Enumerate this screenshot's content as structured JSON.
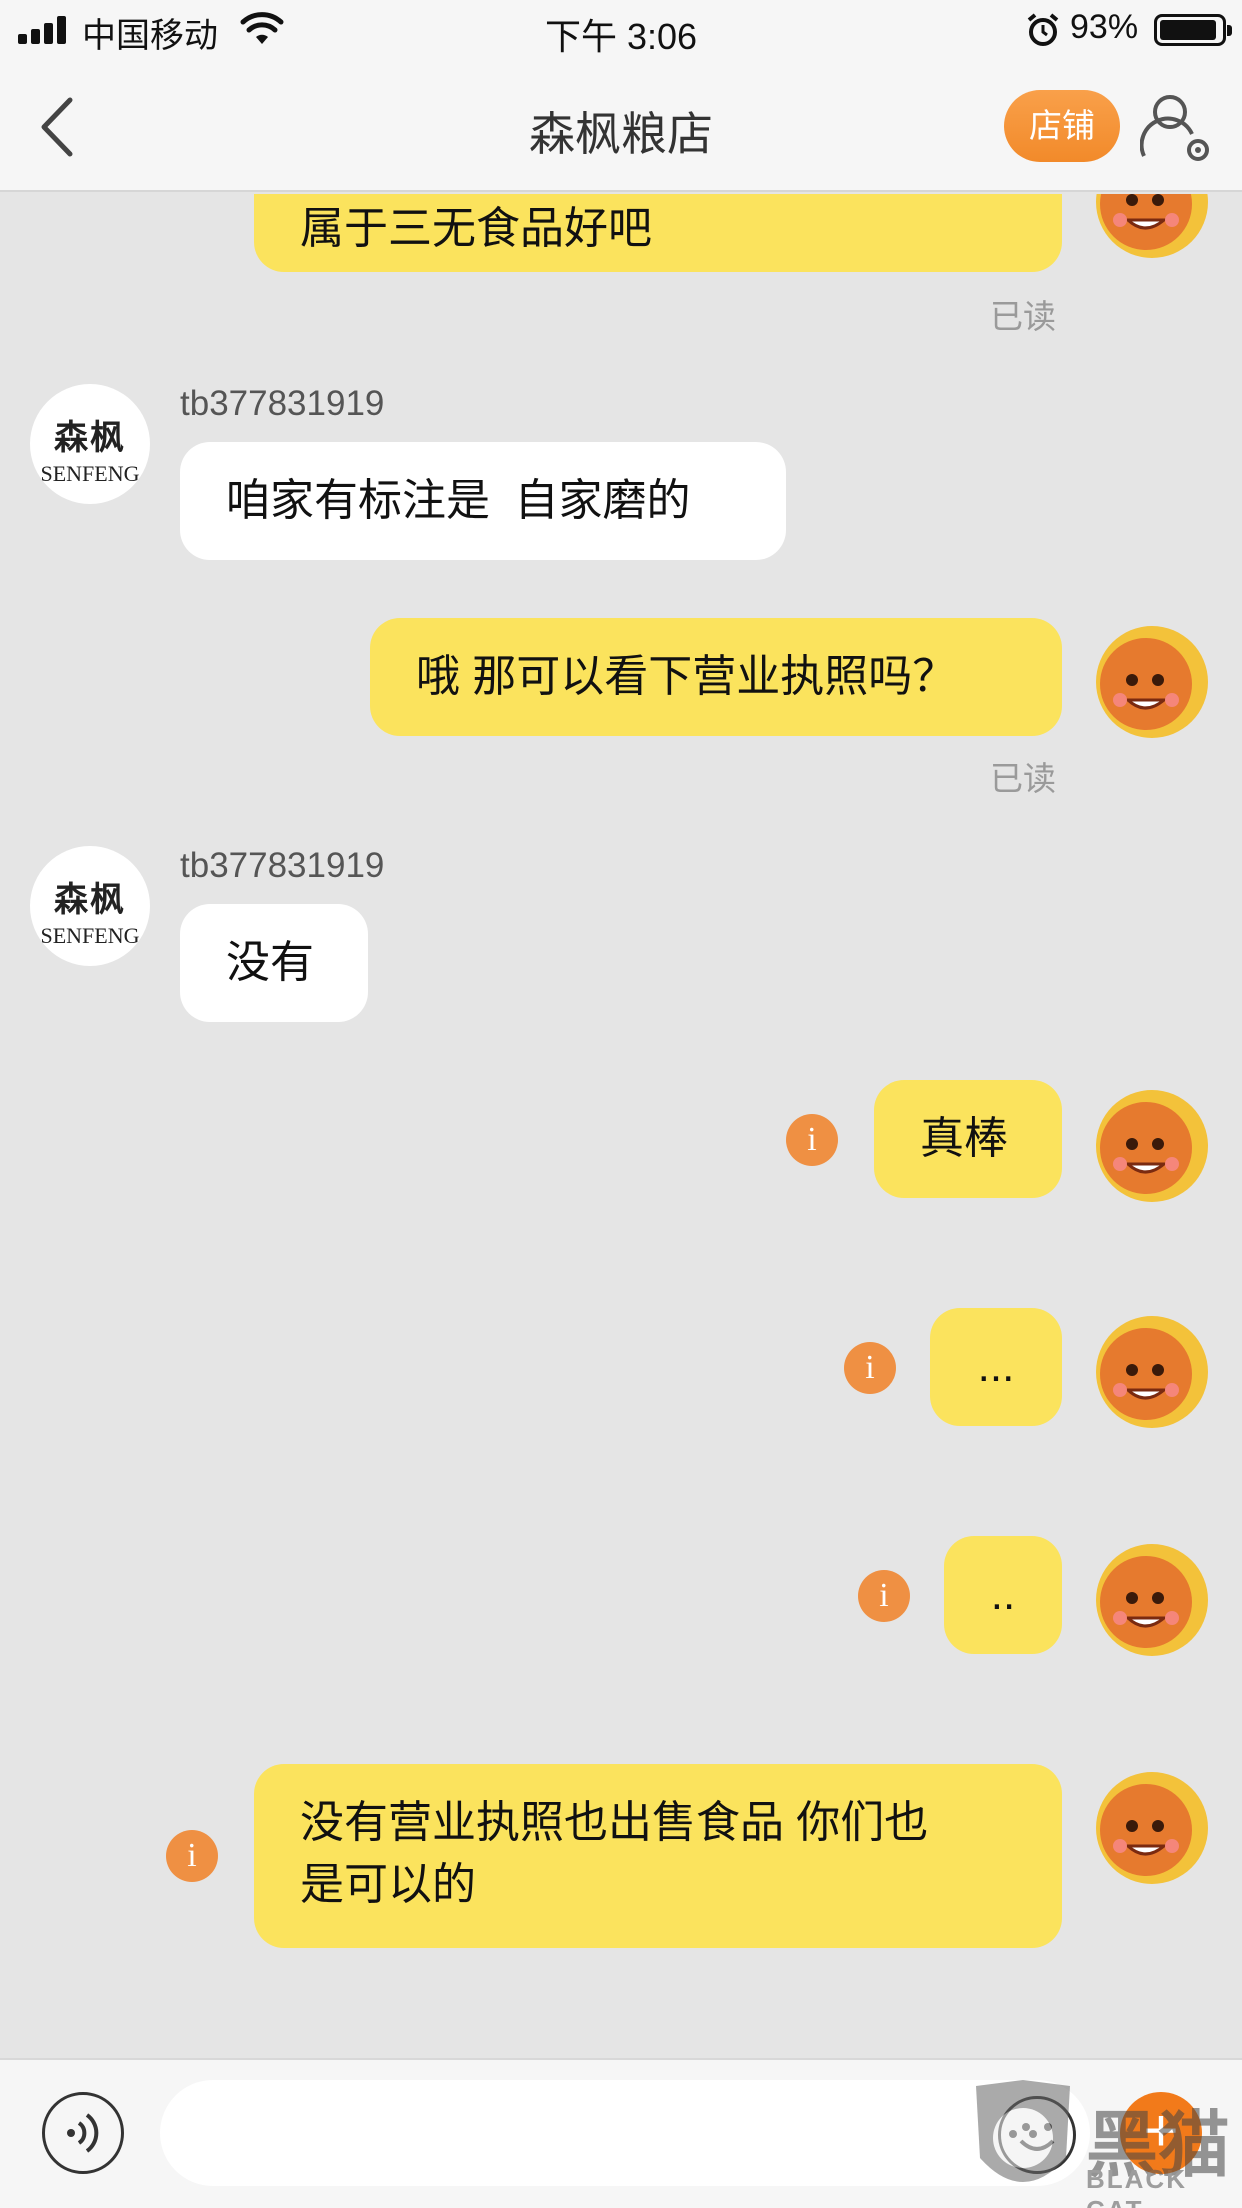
{
  "status_bar": {
    "carrier": "中国移动",
    "time": "下午 3:06",
    "battery_percent": "93%",
    "battery_level": 0.93
  },
  "nav": {
    "title": "森枫粮店",
    "store_button": "店铺",
    "icons": [
      "chevron-left-icon",
      "profile-settings-icon"
    ]
  },
  "shop": {
    "avatar_cn": "森枫",
    "avatar_en": "SENFENG"
  },
  "messages": [
    {
      "side": "out",
      "text": "属于三无食品好吧",
      "status": "已读"
    },
    {
      "side": "in",
      "sender": "tb377831919",
      "text": "咱家有标注是  自家磨的"
    },
    {
      "side": "out",
      "text": "哦 那可以看下营业执照吗？",
      "status": "已读"
    },
    {
      "side": "in",
      "sender": "tb377831919",
      "text": "没有"
    },
    {
      "side": "out",
      "text": "真棒",
      "info": "i"
    },
    {
      "side": "out",
      "text": "...",
      "info": "i"
    },
    {
      "side": "out",
      "text": "..",
      "info": "i"
    },
    {
      "side": "out",
      "text_line1": "没有营业执照也出售食品 你们也",
      "text_line2": "是可以的",
      "info": "i"
    }
  ],
  "input_bar": {
    "placeholder": "",
    "plus_label": "+",
    "icons": [
      "voice-icon",
      "emoji-icon",
      "plus-icon"
    ]
  },
  "watermark": {
    "cn": "黑猫",
    "en": "BLACK CAT"
  },
  "colors": {
    "outgoing_bubble": "#fbe35d",
    "incoming_bubble": "#ffffff",
    "chat_background": "#e5e5e5",
    "accent": "#f28a2a"
  }
}
